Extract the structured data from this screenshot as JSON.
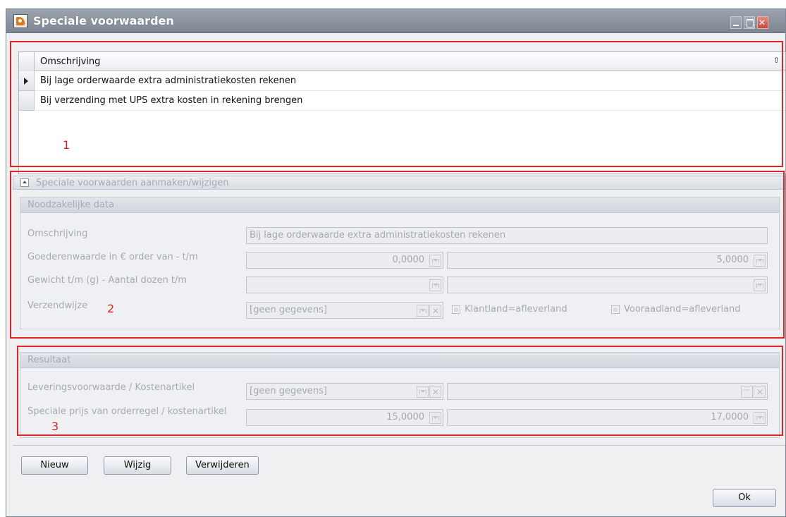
{
  "window": {
    "title": "Speciale voorwaarden"
  },
  "grid": {
    "column_header": "Omschrijving",
    "rows": [
      {
        "text": "Bij lage orderwaarde extra administratiekosten rekenen",
        "selected": true
      },
      {
        "text": "Bij verzending met UPS extra kosten in rekening brengen",
        "selected": false
      }
    ]
  },
  "annotations": {
    "one": "1",
    "two": "2",
    "three": "3"
  },
  "section_edit": {
    "expander_label": "Speciale voorwaarden aanmaken/wijzigen",
    "group_title": "Noodzakelijke data",
    "omschrijving_label": "Omschrijving",
    "omschrijving_value": "Bij lage orderwaarde extra administratiekosten rekenen",
    "goederenwaarde_label": "Goederenwaarde in € order van - t/m",
    "goederenwaarde_from": "0,0000",
    "goederenwaarde_to": "5,0000",
    "gewicht_label": "Gewicht t/m (g) - Aantal dozen t/m",
    "gewicht_value": "",
    "aantal_dozen_value": "",
    "verzendwijze_label": "Verzendwijze",
    "verzendwijze_value": "[geen gegevens]",
    "klantland_label": "Klantland=afleverland",
    "vooraadland_label": "Vooraadland=afleverland"
  },
  "section_result": {
    "group_title": "Resultaat",
    "levering_label": "Leveringsvoorwaarde / Kostenartikel",
    "levering_value": "[geen gegevens]",
    "kostenartikel_value": "",
    "speciale_prijs_label": "Speciale prijs van orderregel / kostenartikel",
    "speciale_prijs_value": "15,0000",
    "kostenartikel_prijs_value": "17,0000"
  },
  "buttons": {
    "nieuw": "Nieuw",
    "wijzig": "Wijzig",
    "verwijderen": "Verwijderen",
    "ok": "Ok"
  },
  "colors": {
    "annotation_red": "#e32424",
    "disabled_text": "#a5abb4",
    "titlebar": "#8a929e"
  }
}
